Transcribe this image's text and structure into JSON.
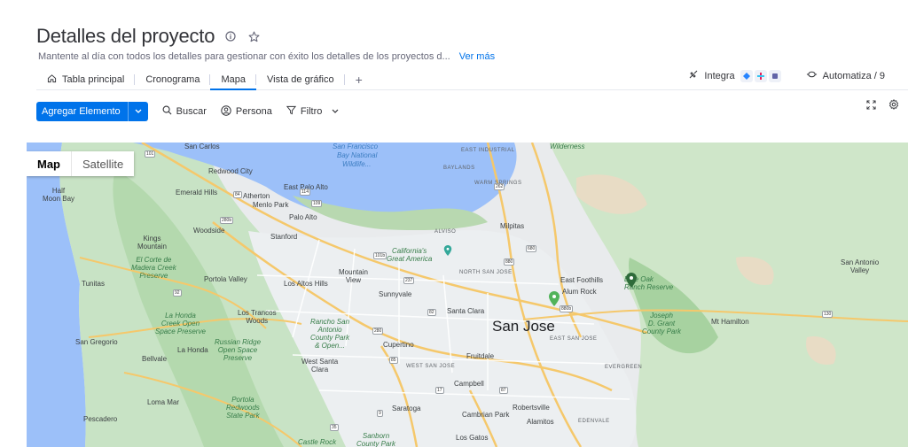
{
  "header": {
    "title": "Detalles del proyecto",
    "description": "Mantente al día con todos los detalles para gestionar con éxito los detalles de los proyectos d...",
    "see_more": "Ver más"
  },
  "tabs": [
    {
      "label": "Tabla principal",
      "icon": "home-icon"
    },
    {
      "label": "Cronograma"
    },
    {
      "label": "Mapa",
      "active": true
    },
    {
      "label": "Vista de gráfico"
    },
    {
      "label": "+"
    }
  ],
  "right_tools": {
    "integrate_label": "Integra",
    "automate_label": "Automatiza / 9"
  },
  "toolbar": {
    "new_item_label": "Agregar Elemento",
    "search_label": "Buscar",
    "person_label": "Persona",
    "filter_label": "Filtro"
  },
  "map": {
    "toggle_map": "Map",
    "toggle_satellite": "Satellite",
    "labels": {
      "san_carlos": "San Carlos",
      "sf_bay_1": "San Francisco",
      "sf_bay_2": "Bay National",
      "sf_bay_3": "Wildlife...",
      "wilderness": "Wilderness",
      "east_industrial": "EAST INDUSTRIAL",
      "baylands": "BAYLANDS",
      "redwood_city": "Redwood City",
      "warm_springs": "WARM SPRINGS",
      "half_moon_bay": "Half\nMoon Bay",
      "emerald_hills": "Emerald Hills",
      "east_palo_alto": "East Palo Alto",
      "atherton": "Atherton",
      "menlo_park": "Menlo Park",
      "palo_alto": "Palo Alto",
      "woodside": "Woodside",
      "stanford": "Stanford",
      "milpitas": "Milpitas",
      "alviso": "ALVISO",
      "kings_mountain": "Kings\nMountain",
      "el_corte": "El Corte de\nMadera Creek\nPreserve",
      "great_america": "California's\nGreat America",
      "north_san_jose": "NORTH SAN JOSE",
      "tunitas": "Tunitas",
      "portola_valley": "Portola Valley",
      "los_altos_hills": "Los Altos Hills",
      "mountain_view": "Mountain\nView",
      "sunnyvale": "Sunnyvale",
      "east_foothills": "East Foothills",
      "alum_rock": "Alum Rock",
      "blue_oak": "Blue Oak\nRanch Reserve",
      "san_antonio_valley": "San Antonio\nValley",
      "la_honda_creek": "La Honda\nCreek Open\nSpace Preserve",
      "los_trancos": "Los Trancos\nWoods",
      "rancho_san_antonio": "Rancho San\nAntonio\nCounty Park\n& Open...",
      "santa_clara": "Santa Clara",
      "san_jose": "San Jose",
      "joseph_grant": "Joseph\nD. Grant\nCounty Park",
      "mt_hamilton": "Mt Hamilton",
      "san_gregorio": "San Gregorio",
      "russian_ridge": "Russian Ridge\nOpen Space\nPreserve",
      "la_honda": "La Honda",
      "cupertino": "Cupertino",
      "east_san_jose": "EAST SAN JOSE",
      "bellvale": "Bellvale",
      "west_santa_clara": "West Santa\nClara",
      "fruitdale": "Fruitdale",
      "west_san_jose": "WEST SAN JOSE",
      "evergreen": "EVERGREEN",
      "campbell": "Campbell",
      "loma_mar": "Loma Mar",
      "portola_redwoods": "Portola\nRedwoods\nState Park",
      "saratoga": "Saratoga",
      "robertsville": "Robertsville",
      "pescadero": "Pescadero",
      "cambrian_park": "Cambrian Park",
      "alamitos": "Alamitos",
      "edenvale": "EDENVALE",
      "castle_rock": "Castle Rock",
      "sanborn": "Sanborn\nCounty Park",
      "los_gatos": "Los Gatos"
    },
    "shields": [
      "101",
      "880",
      "680",
      "237",
      "82",
      "85",
      "280",
      "17",
      "87",
      "130",
      "35",
      "9",
      "84",
      "109",
      "114",
      "92",
      "262",
      "101b",
      "880b",
      "280b"
    ]
  }
}
